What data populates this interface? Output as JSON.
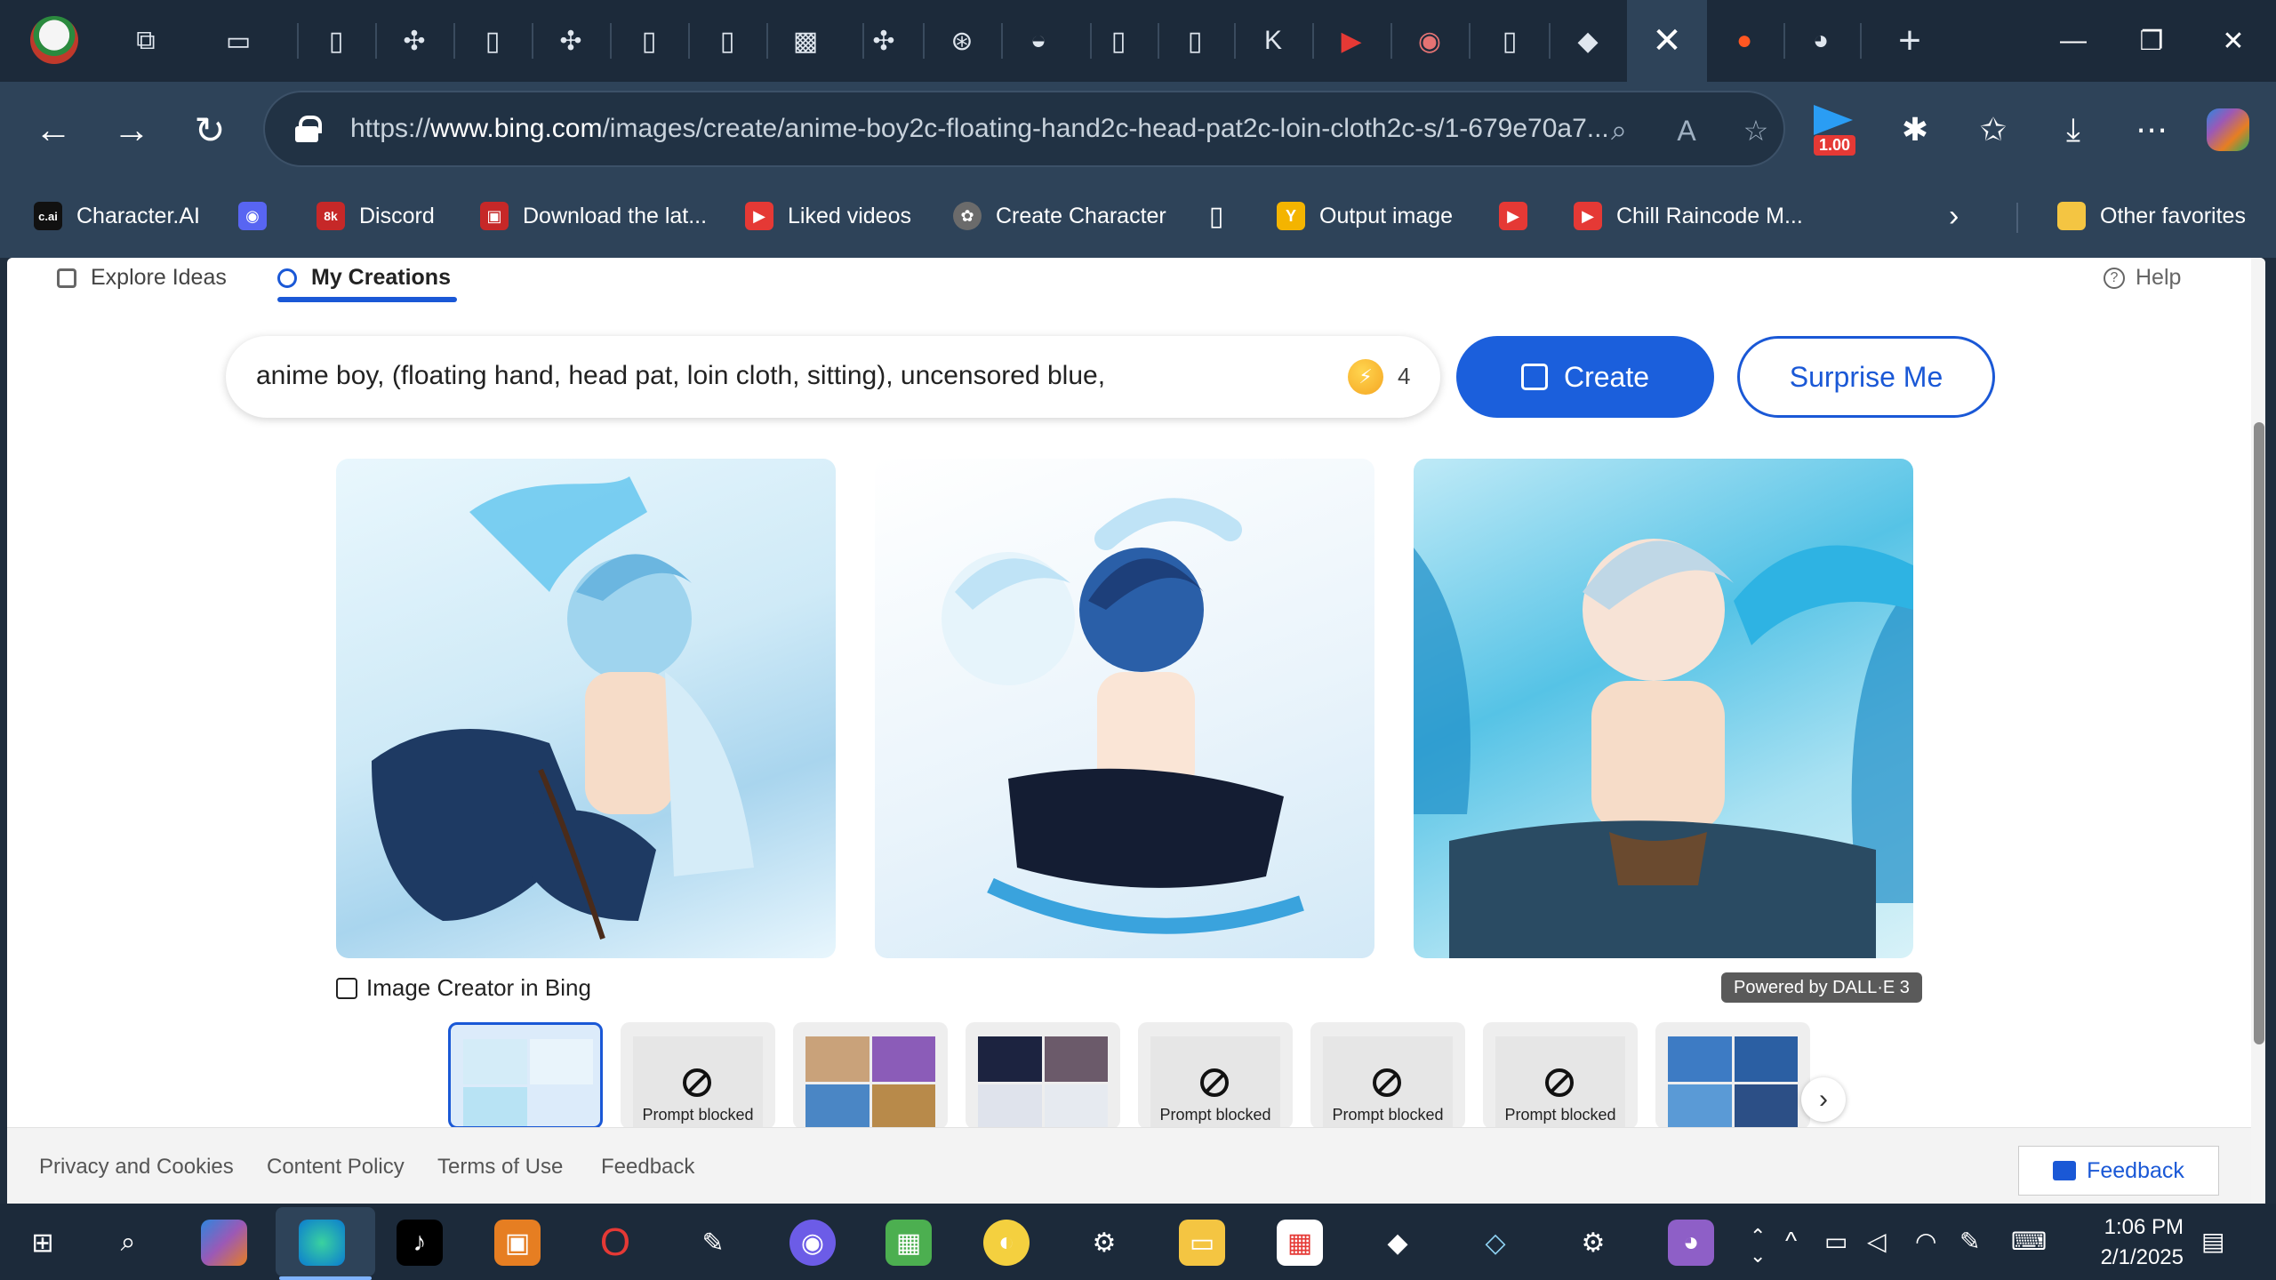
{
  "browser": {
    "url_prefix": "https://",
    "url_host": "www.bing.com",
    "url_path": "/images/create/anime-boy2c-floating-hand2c-head-pat2c-loin-cloth2c-s/1-679e70a7...",
    "extension_badge": "1.00",
    "active_tab_close": "✕",
    "new_tab": "+"
  },
  "favorites": [
    {
      "label": "Character.AI",
      "icon_text": "c.ai",
      "color": "#111111"
    },
    {
      "label": "",
      "icon_text": "◉",
      "color": "#5865f2"
    },
    {
      "label": "Discord",
      "icon_text": "8k",
      "color": "#c62828"
    },
    {
      "label": "Download the lat...",
      "icon_text": "▣",
      "color": "#c62828"
    },
    {
      "label": "Liked videos",
      "icon_text": "▶",
      "color": "#e53935"
    },
    {
      "label": "Create Character",
      "icon_text": "✿",
      "color": "#6b6b6b"
    },
    {
      "label": "",
      "icon_text": "▯",
      "color": "#2e4359"
    },
    {
      "label": "Output image",
      "icon_text": "Y",
      "color": "#f4b400"
    },
    {
      "label": "",
      "icon_text": "▶",
      "color": "#e53935"
    },
    {
      "label": "Chill Raincode M...",
      "icon_text": "▶",
      "color": "#e53935"
    }
  ],
  "other_favorites": "Other favorites",
  "page": {
    "tabs": {
      "explore": "Explore Ideas",
      "mine": "My Creations"
    },
    "help": "Help",
    "prompt": "anime boy, (floating hand, head pat, loin cloth, sitting), uncensored blue,",
    "boost_count": "4",
    "create_label": "Create",
    "surprise_label": "Surprise Me",
    "caption": "Image Creator in Bing",
    "dalle_badge": "Powered by DALL·E 3",
    "blocked_label": "Prompt blocked"
  },
  "footer": {
    "privacy": "Privacy and Cookies",
    "content_policy": "Content Policy",
    "terms": "Terms of Use",
    "feedback": "Feedback",
    "feedback_button": "Feedback"
  },
  "taskbar": {
    "time": "1:06 PM",
    "date": "2/1/2025"
  }
}
